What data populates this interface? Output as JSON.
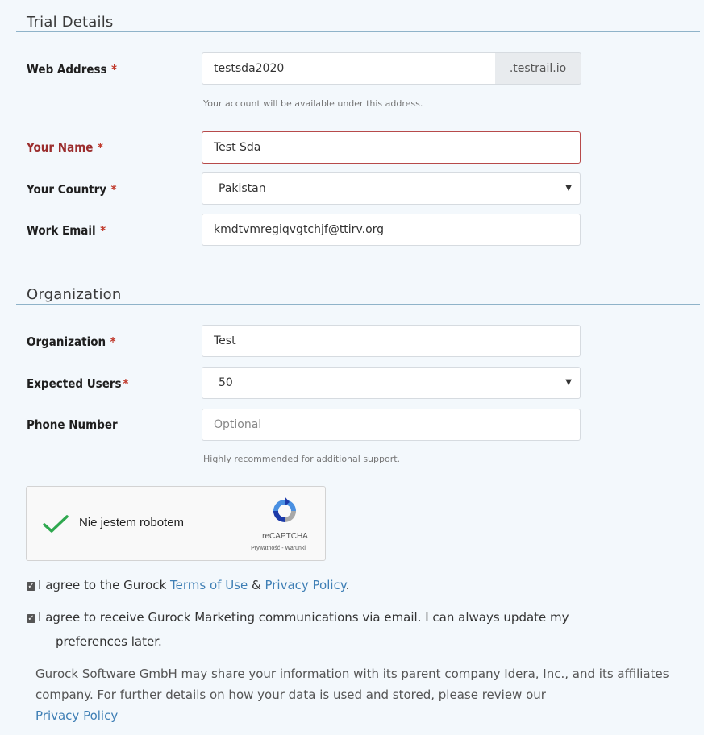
{
  "trial": {
    "title": "Trial Details",
    "web_address": {
      "label": "Web Address",
      "required_mark": "*",
      "value": "testsda2020",
      "suffix": ".testrail.io",
      "help": "Your account will be available under this address."
    },
    "your_name": {
      "label": "Your Name",
      "required_mark": "*",
      "value": "Test Sda"
    },
    "your_country": {
      "label": "Your Country",
      "required_mark": "*",
      "value": "Pakistan"
    },
    "work_email": {
      "label": "Work Email",
      "required_mark": "*",
      "value": "kmdtvmregiqvgtchjf@ttirv.org"
    }
  },
  "organization": {
    "title": "Organization",
    "organization": {
      "label": "Organization",
      "required_mark": "*",
      "value": "Test"
    },
    "expected_users": {
      "label": "Expected Users",
      "required_mark": "*",
      "value": "50"
    },
    "phone_number": {
      "label": "Phone Number",
      "placeholder": "Optional",
      "help": "Highly recommended for additional support."
    }
  },
  "captcha": {
    "text": "Nie jestem robotem",
    "brand": "reCAPTCHA",
    "links": "Prywatność - Warunki",
    "checked": true
  },
  "agreements": {
    "terms": {
      "prefix": "I agree to the Gurock ",
      "terms_link": "Terms of Use",
      "amp": " & ",
      "privacy_link": "Privacy Policy",
      "suffix": ".",
      "checked": true
    },
    "marketing": {
      "line1": "I agree to receive Gurock Marketing communications via email. I can always update my",
      "line2": "preferences later.",
      "checked": true
    }
  },
  "disclaimer": {
    "text": "Gurock Software GmbH may share your information with its parent company Idera, Inc., and its affiliates company. For further details on how your data is used and stored, please review our",
    "link": "Privacy Policy"
  },
  "colors": {
    "background": "#f3f8fc",
    "link": "#3f7fb5",
    "error": "#9b2d2d",
    "required": "#c0392b",
    "check_green": "#2fa84f"
  }
}
